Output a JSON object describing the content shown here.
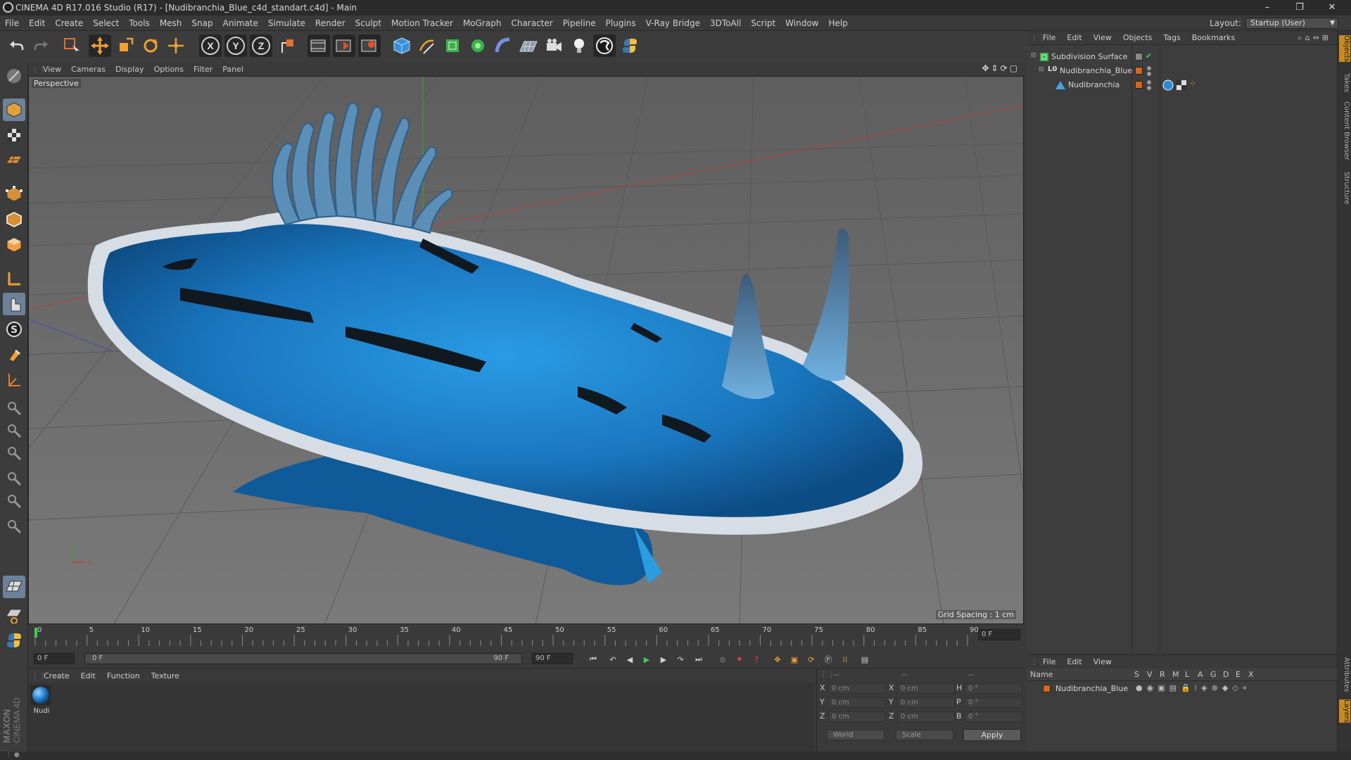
{
  "window": {
    "title": "CINEMA 4D R17.016 Studio (R17) - [Nudibranchia_Blue_c4d_standart.c4d] - Main",
    "controls": [
      "–",
      "❐",
      "✕"
    ]
  },
  "menubar": {
    "items": [
      "File",
      "Edit",
      "Create",
      "Select",
      "Tools",
      "Mesh",
      "Snap",
      "Animate",
      "Simulate",
      "Render",
      "Sculpt",
      "Motion Tracker",
      "MoGraph",
      "Character",
      "Pipeline",
      "Plugins",
      "V-Ray Bridge",
      "3DToAll",
      "Script",
      "Window",
      "Help"
    ],
    "layout_label": "Layout:",
    "layout_value": "Startup (User)"
  },
  "toolbar": {
    "axis_x": "X",
    "axis_y": "Y",
    "axis_z": "Z"
  },
  "viewport": {
    "menu": [
      "View",
      "Cameras",
      "Display",
      "Options",
      "Filter",
      "Panel"
    ],
    "label": "Perspective",
    "grid_spacing": "Grid Spacing : 1 cm"
  },
  "timeline": {
    "ticks": [
      "0",
      "5",
      "10",
      "15",
      "20",
      "25",
      "30",
      "35",
      "40",
      "45",
      "50",
      "55",
      "60",
      "65",
      "70",
      "75",
      "80",
      "85",
      "90"
    ],
    "current_frame": "0 F",
    "start_field": "0 F",
    "range_start": "0 F",
    "range_end": "90 F",
    "end_field": "90 F"
  },
  "material_manager": {
    "menu": [
      "Create",
      "Edit",
      "Function",
      "Texture"
    ],
    "materials": [
      {
        "name": "Nudi"
      }
    ]
  },
  "coordinates": {
    "header": [
      "--",
      "--",
      "--"
    ],
    "rows": [
      {
        "axis": "X",
        "pos": "0 cm",
        "size_axis": "X",
        "size": "0 cm",
        "rot_axis": "H",
        "rot": "0 °"
      },
      {
        "axis": "Y",
        "pos": "0 cm",
        "size_axis": "Y",
        "size": "0 cm",
        "rot_axis": "P",
        "rot": "0 °"
      },
      {
        "axis": "Z",
        "pos": "0 cm",
        "size_axis": "Z",
        "size": "0 cm",
        "rot_axis": "B",
        "rot": "0 °"
      }
    ],
    "space": "World",
    "mode": "Scale",
    "apply": "Apply"
  },
  "object_manager": {
    "menu": [
      "File",
      "Edit",
      "View",
      "Objects",
      "Tags",
      "Bookmarks"
    ],
    "objects": [
      {
        "name": "Subdivision Surface"
      },
      {
        "name": "Nudibranchia_Blue"
      },
      {
        "name": "Nudibranchia"
      }
    ]
  },
  "layer_manager": {
    "menu": [
      "File",
      "Edit",
      "View"
    ],
    "columns": [
      "Name",
      "S",
      "V",
      "R",
      "M",
      "L",
      "A",
      "G",
      "D",
      "E",
      "X"
    ],
    "layers": [
      {
        "name": "Nudibranchia_Blue"
      }
    ]
  },
  "side_tabs": [
    "Objects",
    "Takes",
    "Content Browser",
    "Structure",
    "Attributes",
    "Layers"
  ],
  "branding": "MAXON CINEMA 4D",
  "colors": {
    "selected_tool": "#6d8299",
    "layer_orange": "#d8641e",
    "slug_blue": "#1f8ed6"
  }
}
